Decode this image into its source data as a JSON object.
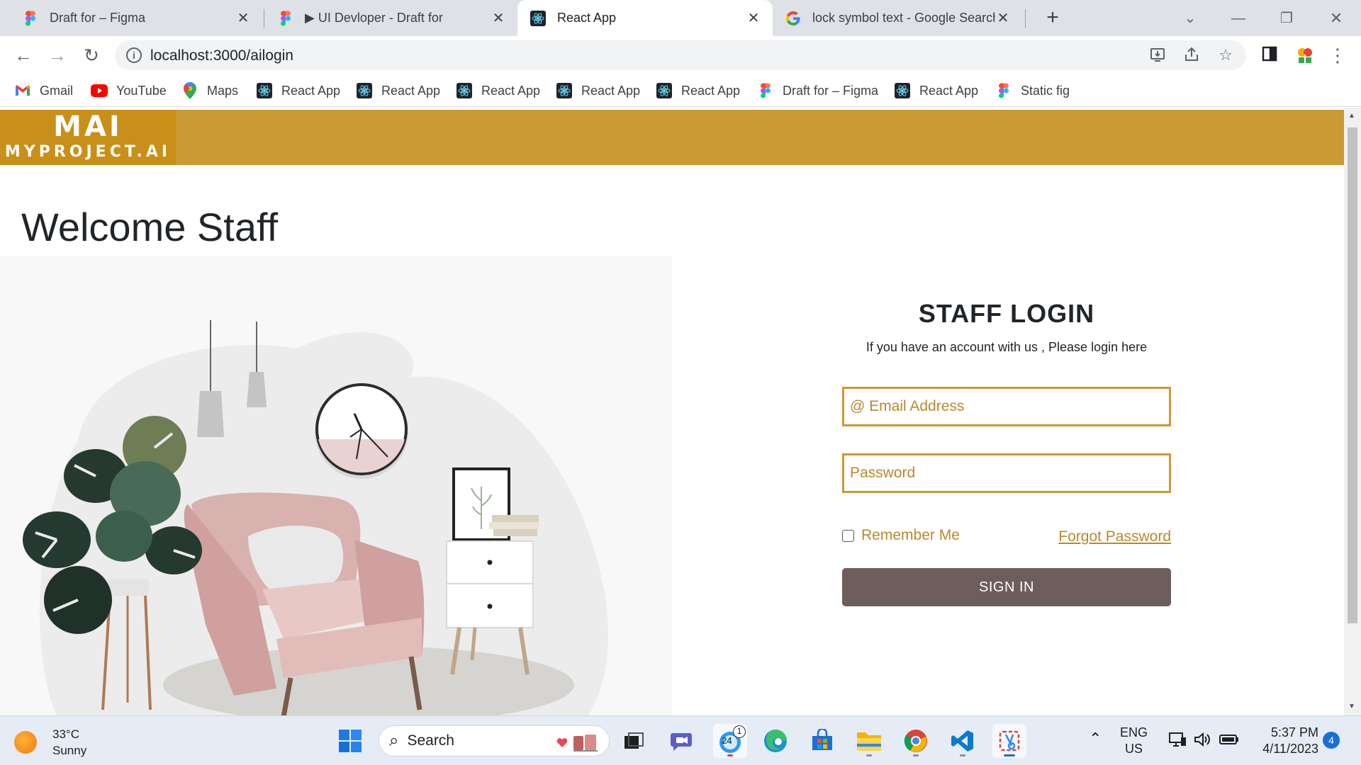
{
  "browser": {
    "tabs": [
      {
        "title": "Draft for – Figma",
        "icon": "figma-icon",
        "active": false
      },
      {
        "title": "▶ UI Devloper - Draft for",
        "icon": "figma-icon",
        "active": false
      },
      {
        "title": "React App",
        "icon": "react-icon",
        "active": true
      },
      {
        "title": "lock symbol text - Google Search",
        "icon": "google-icon",
        "active": false
      }
    ],
    "url": "localhost:3000/ailogin",
    "bookmarks": [
      {
        "label": "Gmail",
        "icon": "gmail-icon"
      },
      {
        "label": "YouTube",
        "icon": "youtube-icon"
      },
      {
        "label": "Maps",
        "icon": "maps-icon"
      },
      {
        "label": "React App",
        "icon": "react-icon"
      },
      {
        "label": "React App",
        "icon": "react-icon"
      },
      {
        "label": "React App",
        "icon": "react-icon"
      },
      {
        "label": "React App",
        "icon": "react-icon"
      },
      {
        "label": "React App",
        "icon": "react-icon"
      },
      {
        "label": "Draft for – Figma",
        "icon": "figma-icon"
      },
      {
        "label": "React App",
        "icon": "react-icon"
      },
      {
        "label": "Static fig",
        "icon": "figma-icon"
      }
    ]
  },
  "page": {
    "logo": {
      "line1": "MAI",
      "line2": "MYPROJECT.AI"
    },
    "heading": "Welcome Staff",
    "login": {
      "title": "STAFF LOGIN",
      "subtitle": "If you have an account with us , Please login here",
      "email_placeholder": "@ Email Address",
      "password_placeholder": "Password",
      "remember_label": "Remember Me",
      "forgot_label": "Forgot Password",
      "signin_label": "SIGN IN"
    },
    "colors": {
      "accent": "#cc9935",
      "button": "#6e5d5d",
      "field_text": "#b8892b"
    }
  },
  "taskbar": {
    "weather": {
      "temp": "33°C",
      "condition": "Sunny"
    },
    "search_placeholder": "Search",
    "teams_badge": "1",
    "calendar_day": "24",
    "language": {
      "line1": "ENG",
      "line2": "US"
    },
    "clock": {
      "time": "5:37 PM",
      "date": "4/11/2023"
    },
    "notifications": "4"
  }
}
